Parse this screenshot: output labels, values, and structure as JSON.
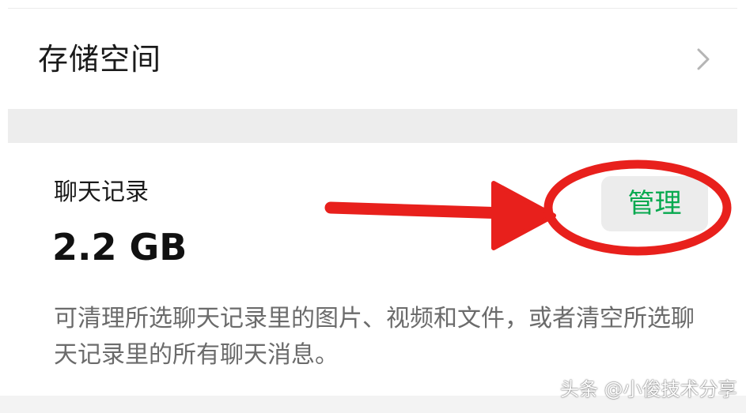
{
  "storage": {
    "label": "存储空间",
    "chevron_icon": "chevron-right-icon"
  },
  "chat_history": {
    "title": "聊天记录",
    "size": "2.2 GB",
    "description": "可清理所选聊天记录里的图片、视频和文件，或者清空所选聊天记录里的所有聊天消息。",
    "manage_label": "管理"
  },
  "watermark": {
    "text": "头条 @小俊技术分享"
  },
  "colors": {
    "accent_green": "#07a94f",
    "annotation_red": "#e8201c",
    "section_gap": "#ededed",
    "button_bg": "#ececec"
  }
}
